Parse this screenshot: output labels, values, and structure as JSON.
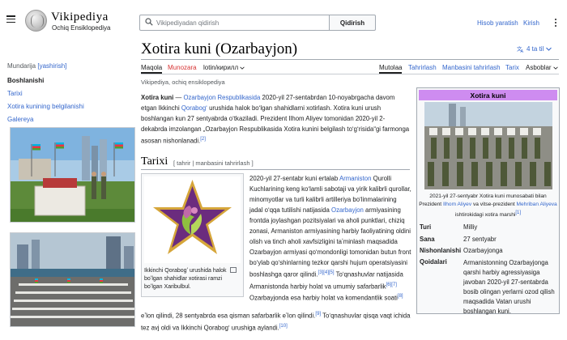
{
  "header": {
    "logo_wordmark": "Vikipediya",
    "tagline": "Ochiq Ensiklopediya",
    "search_placeholder": "Vikipediyadan qidirish",
    "search_button": "Qidirish",
    "create_account": "Hisob yaratish",
    "login": "Kirish"
  },
  "sidebar": {
    "toc_title": "Mundarija",
    "toc_hide": "[yashirish]",
    "items": [
      "Boshlanishi",
      "Tarixi",
      "Xotira kunining belgilanishi",
      "Galereya"
    ]
  },
  "page": {
    "title": "Xotira kuni (Ozarbayjon)",
    "languages": "4 ta til",
    "site_sub": "Vikipediya, ochiq ensiklopediya"
  },
  "tabs": {
    "article": "Maqola",
    "talk": "Munozara",
    "script": "lotin/кирилл",
    "read": "Mutolaa",
    "edit": "Tahrirlash",
    "edit_source": "Manbasini tahrirlash",
    "history": "Tarix",
    "tools": "Asboblar"
  },
  "lead": {
    "term": "Xotira kuni",
    "dash": " — ",
    "link1": "Ozarbayjon Respublikasida",
    "text1": " 2020-yil 27-sentabrdan 10-noyabrgacha davom etgan Ikkinchi ",
    "link2": "Qorabogʻ",
    "text2": " urushida halok boʻlgan shahidlarni xotirlash. Xotira kuni urush boshlangan kun 27 sentyabrda oʻtkaziladi. Prezident Ilhom Aliyev tomonidan 2020-yil 2-dekabrda imzolangan „Ozarbayjon Respublikasida Xotira kunini belgilash toʻgʻrisida“gi farmonga asosan nishonlanadi.",
    "cite": "[2]"
  },
  "section": {
    "heading": "Tarixi",
    "edit_links": "[ tahrir | manbasini tahrirlash ]",
    "thumb_caption": "Ikkinchi Qorabogʻ urushida halok boʻlgan shahidlar xotirasi ramzi boʻlgan Xaribulbul.",
    "p_a": "2020-yil 27-sentabr kuni ertalab ",
    "p_link1": "Armaniston",
    "p_b": " Qurolli Kuchlarining keng koʻlamli sabotaji va yirik kalibrli qurollar, minomyotlar va turli kalibrli artilleriya boʻlinmalarining jadal oʻqqa tutilishi natijasida ",
    "p_link2": "Ozarbayjon",
    "p_c": " armiyasining frontda joylashgan pozitsiyalari va aholi punktlari, chiziq zonasi, Armaniston armiyasining harbiy faoliyatining oldini olish va tinch aholi xavfsizligini taʼminlash maqsadida Ozarbayjon armiyasi qoʻmondonligi tomonidan butun front boʻylab qoʻshinlarning tezkor qarshi hujum operatsiyasini boshlashga qaror qilindi.",
    "cite1": "[3][4][5]",
    "p_d": " Toʻqnashuvlar natijasida Armanistonda harbiy holat va umumiy safarbarlik",
    "cite2": "[6][7]",
    "p_e": " Ozarbayjonda esa harbiy holat va komendantlik soati",
    "cite3": "[8]",
    "tail_a": "eʼlon qilindi, 28 sentyabrda esa qisman safarbarlik eʼlon qilindi.",
    "cite4": "[9]",
    "tail_b": " Toʻqnashuvlar qisqa vaqt ichida tez avj oldi va Ikkinchi Qorabogʻ urushiga aylandi.",
    "cite5": "[10]"
  },
  "infobox": {
    "title": "Xotira kuni",
    "caption_a": "2021-yil 27-sentyabr Xotira kuni munosabati bilan Prezident ",
    "caption_link1": "Ilhom Aliyev",
    "caption_b": " va vitse-prezident ",
    "caption_link2": "Mehriban Aliyeva",
    "caption_c": " ishtirokidagi xotira marshi",
    "caption_cite": "[1]",
    "rows": [
      {
        "label": "Turi",
        "value": "Milliy"
      },
      {
        "label": "Sana",
        "value": "27 sentyabr"
      },
      {
        "label": "Nishonlanishi",
        "value": "Ozarbayjonga"
      },
      {
        "label": "Qoidalari",
        "value": "Armanistonning Ozarbayjonga qarshi harbiy agressiyasiga javoban 2020-yil 27-sentabrda bosib olingan yerlarni ozod qilish maqsadida Vatan urushi boshlangan kuni."
      }
    ]
  },
  "colors": {
    "link": "#3366cc",
    "new_link": "#d73333",
    "infobox_header": "#ce8cf0",
    "star_purple": "#6b2c7e",
    "star_gold": "#d6a63a"
  },
  "icons": [
    "menu-icon",
    "wikipedia-globe-icon",
    "search-icon",
    "more-icon",
    "language-icon",
    "chevron-down-icon",
    "enlarge-icon"
  ]
}
